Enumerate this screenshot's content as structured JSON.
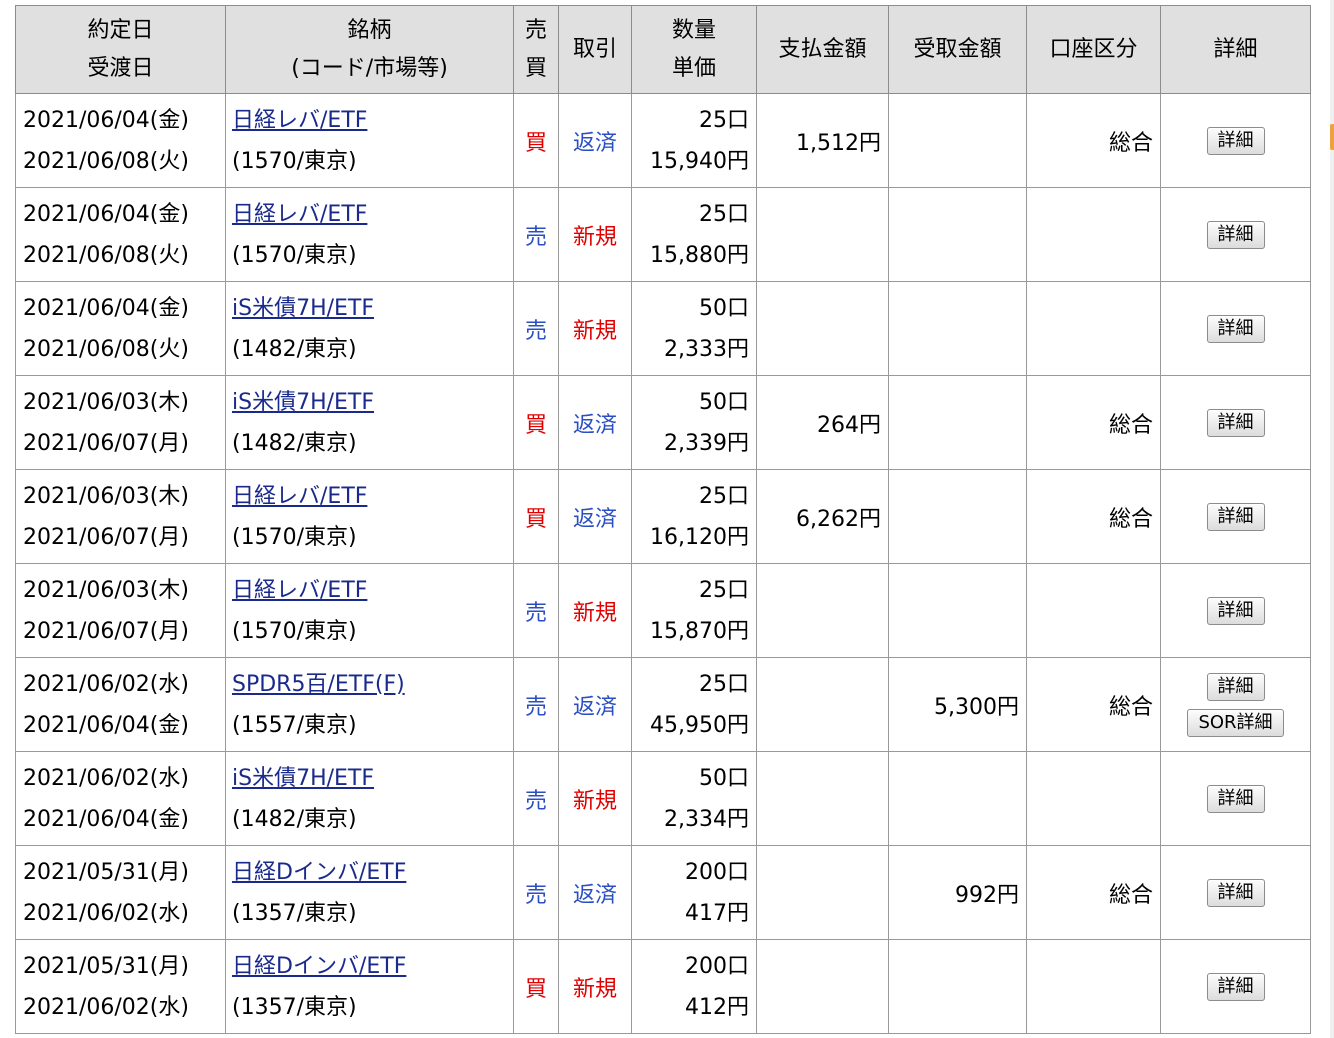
{
  "header": {
    "date_l1": "約定日",
    "date_l2": "受渡日",
    "name_l1": "銘柄",
    "name_l2": "(コード/市場等)",
    "side_l1": "売",
    "side_l2": "買",
    "trade": "取引",
    "qty_l1": "数量",
    "qty_l2": "単価",
    "pay": "支払金額",
    "recv": "受取金額",
    "account": "口座区分",
    "detail": "詳細"
  },
  "rows": [
    {
      "trade_date": "2021/06/04(金)",
      "settle_date": "2021/06/08(火)",
      "name": "日経レバ/ETF",
      "code": "(1570/東京)",
      "side": "買",
      "side_type": "buy",
      "trade": "返済",
      "trade_type": "sell",
      "qty": "25口",
      "price": "15,940円",
      "pay": "1,512円",
      "recv": "",
      "account": "総合",
      "detail_btn": "詳細",
      "sor_btn": ""
    },
    {
      "trade_date": "2021/06/04(金)",
      "settle_date": "2021/06/08(火)",
      "name": "日経レバ/ETF",
      "code": "(1570/東京)",
      "side": "売",
      "side_type": "sell",
      "trade": "新規",
      "trade_type": "buy",
      "qty": "25口",
      "price": "15,880円",
      "pay": "",
      "recv": "",
      "account": "",
      "detail_btn": "詳細",
      "sor_btn": ""
    },
    {
      "trade_date": "2021/06/04(金)",
      "settle_date": "2021/06/08(火)",
      "name": "iS米債7H/ETF",
      "code": "(1482/東京)",
      "side": "売",
      "side_type": "sell",
      "trade": "新規",
      "trade_type": "buy",
      "qty": "50口",
      "price": "2,333円",
      "pay": "",
      "recv": "",
      "account": "",
      "detail_btn": "詳細",
      "sor_btn": ""
    },
    {
      "trade_date": "2021/06/03(木)",
      "settle_date": "2021/06/07(月)",
      "name": "iS米債7H/ETF",
      "code": "(1482/東京)",
      "side": "買",
      "side_type": "buy",
      "trade": "返済",
      "trade_type": "sell",
      "qty": "50口",
      "price": "2,339円",
      "pay": "264円",
      "recv": "",
      "account": "総合",
      "detail_btn": "詳細",
      "sor_btn": ""
    },
    {
      "trade_date": "2021/06/03(木)",
      "settle_date": "2021/06/07(月)",
      "name": "日経レバ/ETF",
      "code": "(1570/東京)",
      "side": "買",
      "side_type": "buy",
      "trade": "返済",
      "trade_type": "sell",
      "qty": "25口",
      "price": "16,120円",
      "pay": "6,262円",
      "recv": "",
      "account": "総合",
      "detail_btn": "詳細",
      "sor_btn": ""
    },
    {
      "trade_date": "2021/06/03(木)",
      "settle_date": "2021/06/07(月)",
      "name": "日経レバ/ETF",
      "code": "(1570/東京)",
      "side": "売",
      "side_type": "sell",
      "trade": "新規",
      "trade_type": "buy",
      "qty": "25口",
      "price": "15,870円",
      "pay": "",
      "recv": "",
      "account": "",
      "detail_btn": "詳細",
      "sor_btn": ""
    },
    {
      "trade_date": "2021/06/02(水)",
      "settle_date": "2021/06/04(金)",
      "name": "SPDR5百/ETF(F)",
      "code": "(1557/東京)",
      "side": "売",
      "side_type": "sell",
      "trade": "返済",
      "trade_type": "sell",
      "qty": "25口",
      "price": "45,950円",
      "pay": "",
      "recv": "5,300円",
      "account": "総合",
      "detail_btn": "詳細",
      "sor_btn": "SOR詳細"
    },
    {
      "trade_date": "2021/06/02(水)",
      "settle_date": "2021/06/04(金)",
      "name": "iS米債7H/ETF",
      "code": "(1482/東京)",
      "side": "売",
      "side_type": "sell",
      "trade": "新規",
      "trade_type": "buy",
      "qty": "50口",
      "price": "2,334円",
      "pay": "",
      "recv": "",
      "account": "",
      "detail_btn": "詳細",
      "sor_btn": ""
    },
    {
      "trade_date": "2021/05/31(月)",
      "settle_date": "2021/06/02(水)",
      "name": "日経Dインバ/ETF",
      "code": "(1357/東京)",
      "side": "売",
      "side_type": "sell",
      "trade": "返済",
      "trade_type": "sell",
      "qty": "200口",
      "price": "417円",
      "pay": "",
      "recv": "992円",
      "account": "総合",
      "detail_btn": "詳細",
      "sor_btn": ""
    },
    {
      "trade_date": "2021/05/31(月)",
      "settle_date": "2021/06/02(水)",
      "name": "日経Dインバ/ETF",
      "code": "(1357/東京)",
      "side": "買",
      "side_type": "buy",
      "trade": "新規",
      "trade_type": "buy",
      "qty": "200口",
      "price": "412円",
      "pay": "",
      "recv": "",
      "account": "",
      "detail_btn": "詳細",
      "sor_btn": ""
    }
  ],
  "colors": {
    "buy": "#e00000",
    "sell": "#2a4fc4",
    "link": "#1a2a8c",
    "header_bg": "#e0e0e0"
  }
}
